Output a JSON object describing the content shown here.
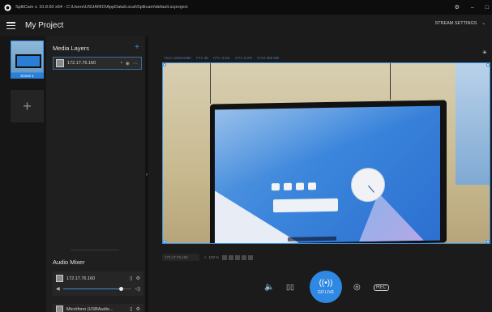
{
  "titlebar": {
    "title": "SplitCam v. 10.8.60 x64 - C:\\Users\\USUARIO\\AppData\\Local\\Splitcam\\default.scproject",
    "settings_glyph": "⚙",
    "minimize_glyph": "–",
    "maximize_glyph": "□"
  },
  "header": {
    "project_title": "My Project",
    "stream_settings_label": "STREAM SETTINGS",
    "chevron_glyph": "⌄"
  },
  "scenes": {
    "items": [
      {
        "label": "Scene 1"
      }
    ],
    "add_glyph": "+"
  },
  "media_layers": {
    "title": "Media Layers",
    "add_glyph": "+",
    "items": [
      {
        "name": "172.17.76.160"
      }
    ]
  },
  "audio_mixer": {
    "title": "Audio Mixer",
    "items": [
      {
        "name": "172.17.76.160",
        "volume": 0.85
      },
      {
        "name": "Micrófono (USBAudio..."
      }
    ]
  },
  "stats": {
    "res_label": "RES",
    "res_value": "1920x1080",
    "fps_label": "FPS",
    "fps_value": "30",
    "cpu_label": "CPU",
    "cpu_value": "3.5%",
    "gpu_label": "GPU",
    "gpu_value": "9.2%",
    "ram_label": "RAM",
    "ram_value": "256 MB"
  },
  "infobar": {
    "source": "172.17.76.160",
    "zoom": "100 %"
  },
  "controls": {
    "go_live_label": "GO LIVE",
    "go_live_glyph": "((•))",
    "speaker_glyph": "🔈",
    "pause_glyph": "▯▯",
    "camera_glyph": "◎",
    "rec_glyph": "REC"
  },
  "colors": {
    "accent": "#2f88e2",
    "background": "#1b1b1b",
    "panel": "#1f1f1f"
  }
}
